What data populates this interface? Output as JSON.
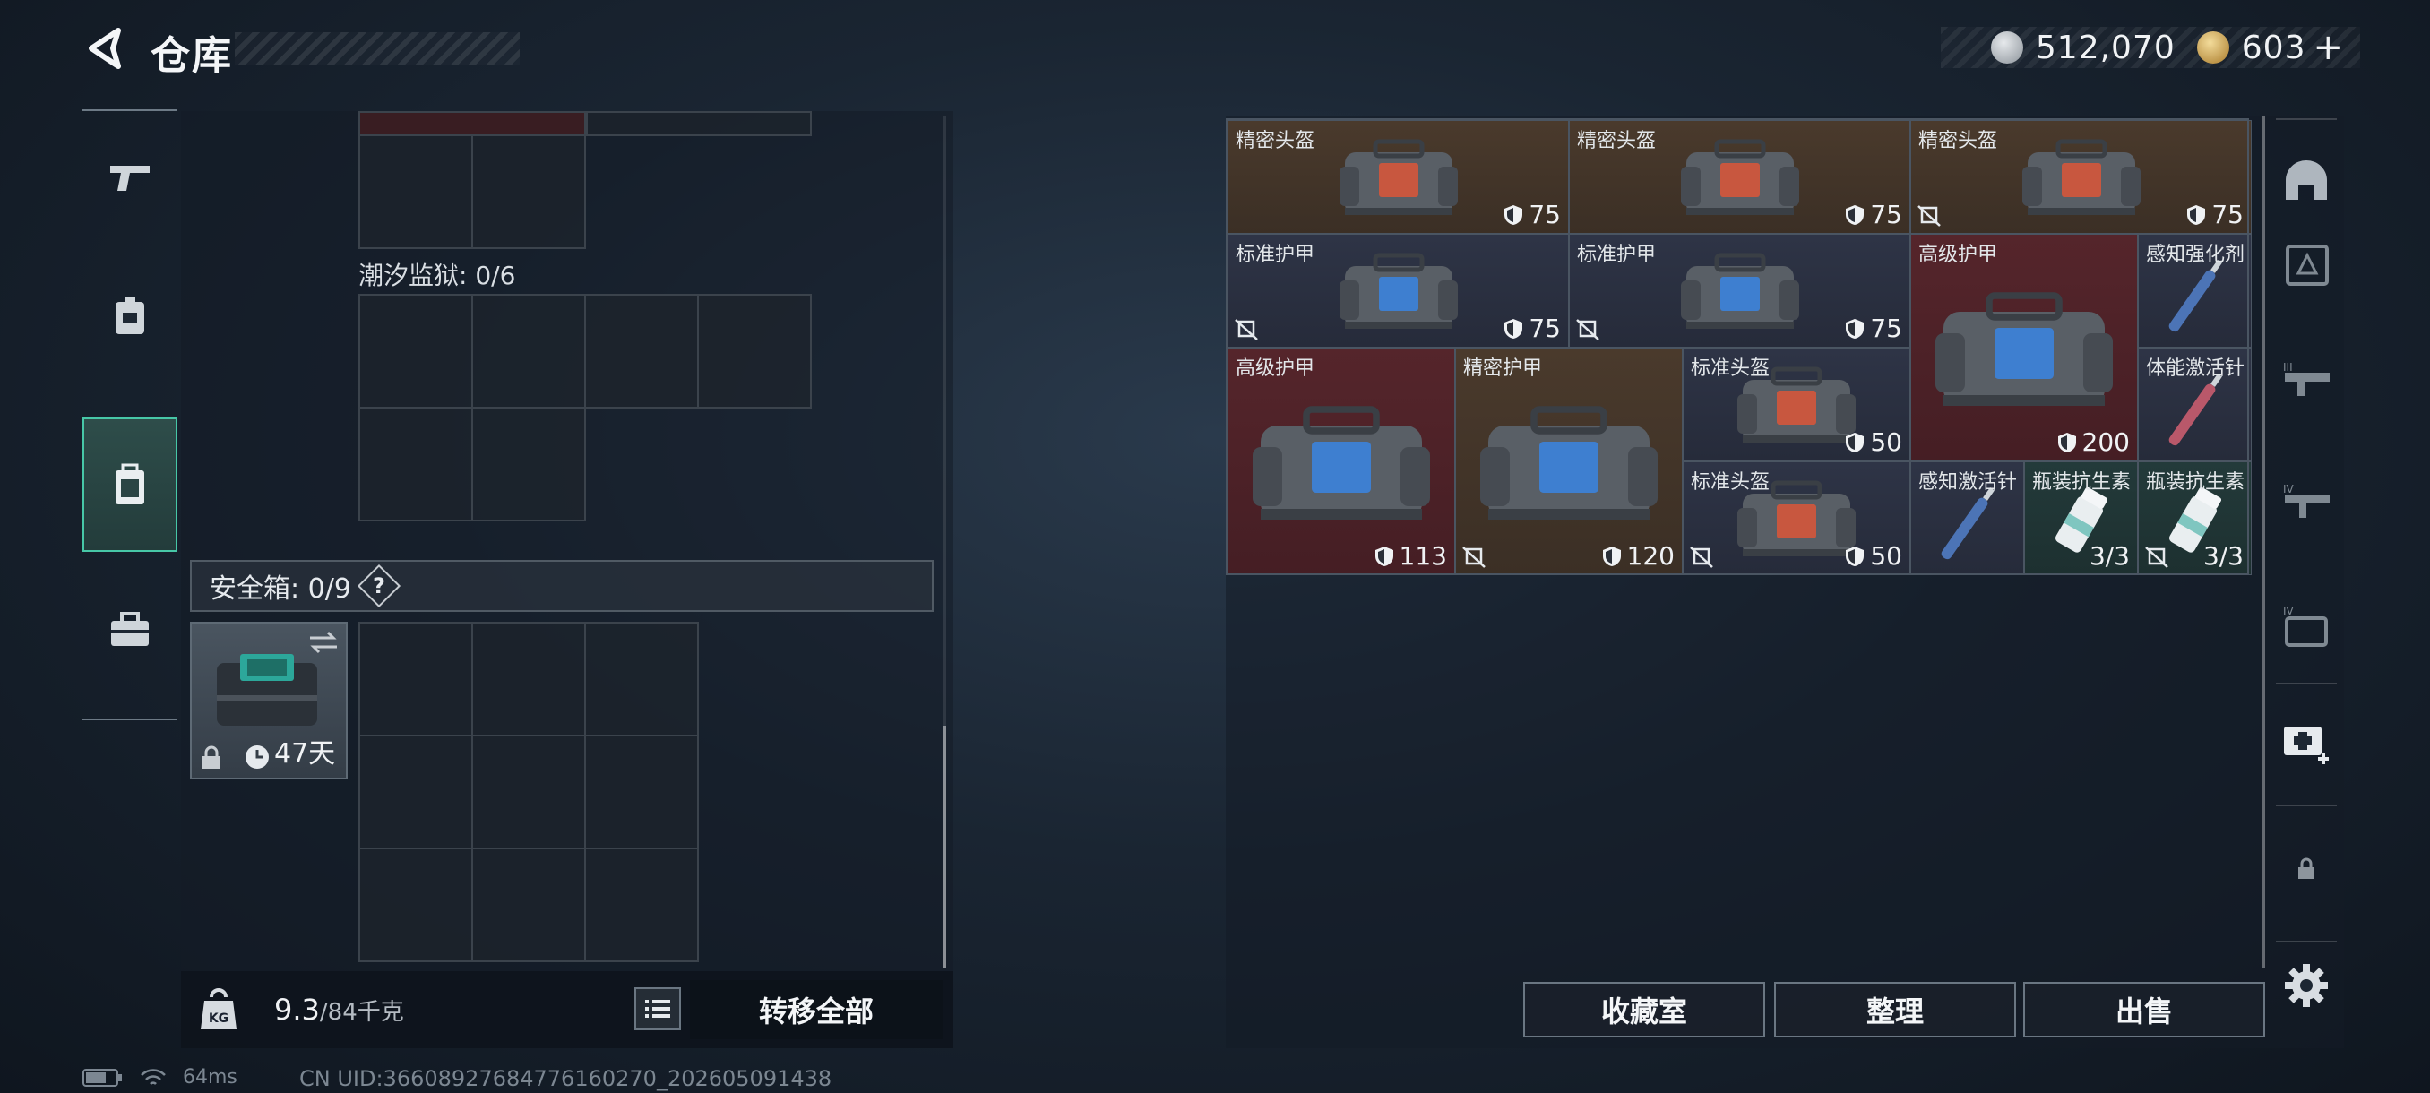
{
  "header": {
    "title": "仓库"
  },
  "currency": {
    "silver": "512,070",
    "gold": "603",
    "plus": "+"
  },
  "rail": {
    "items": [
      "weapon",
      "armor",
      "backpack",
      "toolbox"
    ],
    "active_index": 2
  },
  "left": {
    "tidal_label": "潮汐监狱: 0/6",
    "safe_label": "安全箱: 0/9",
    "safe_help": "?",
    "safe_item": {
      "duration": "47天"
    },
    "weight_current": "9.3",
    "weight_max": "/84千克",
    "transfer_all": "转移全部"
  },
  "items": [
    {
      "name": "精密头盔",
      "value": "75",
      "color": "orange",
      "no_flag": false
    },
    {
      "name": "精密头盔",
      "value": "75",
      "color": "orange",
      "no_flag": false
    },
    {
      "name": "精密头盔",
      "value": "75",
      "color": "orange",
      "no_flag": true
    },
    {
      "name": "标准护甲",
      "value": "75",
      "color": "blue",
      "no_flag": true
    },
    {
      "name": "标准护甲",
      "value": "75",
      "color": "blue",
      "no_flag": true
    },
    {
      "name": "高级护甲",
      "value": "200",
      "color": "red",
      "no_flag": false
    },
    {
      "name": "感知强化剂",
      "value": "",
      "color": "blue",
      "no_flag": false
    },
    {
      "name": "高级护甲",
      "value": "113",
      "color": "red",
      "no_flag": false
    },
    {
      "name": "精密护甲",
      "value": "120",
      "color": "orange",
      "no_flag": true
    },
    {
      "name": "标准头盔",
      "value": "50",
      "color": "blue",
      "no_flag": false
    },
    {
      "name": "体能激活针",
      "value": "",
      "color": "blue",
      "no_flag": false
    },
    {
      "name": "标准头盔",
      "value": "50",
      "color": "blue",
      "no_flag": true
    },
    {
      "name": "感知激活针",
      "value": "",
      "color": "blue",
      "no_flag": false
    },
    {
      "name": "瓶装抗生素",
      "value": "3/3",
      "color": "green",
      "no_flag": false
    },
    {
      "name": "瓶装抗生素",
      "value": "3/3",
      "color": "green",
      "no_flag": true
    }
  ],
  "actions": {
    "collection": "收藏室",
    "sort": "整理",
    "sell": "出售"
  },
  "status": {
    "ping": "64ms",
    "uid": "CN UID:366089276847761602​70_202605091438"
  }
}
